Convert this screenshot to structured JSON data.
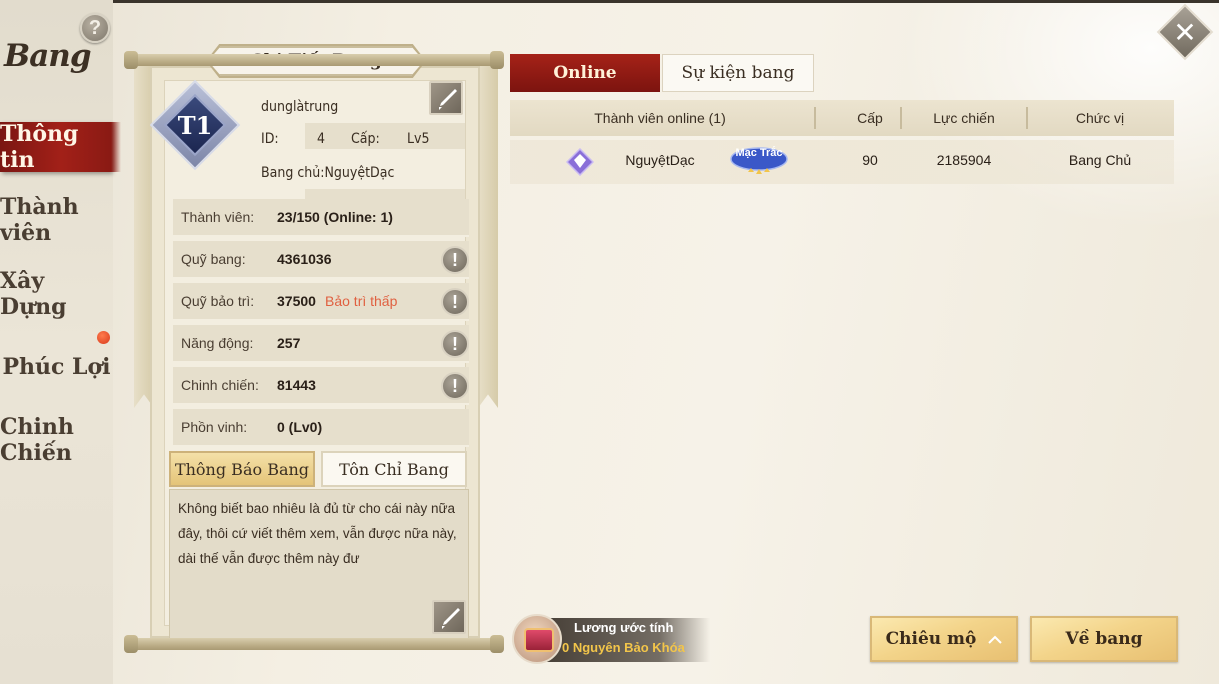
{
  "sidebar": {
    "title": "Bang",
    "help": "?",
    "items": [
      {
        "label": "Thông tin",
        "active": true
      },
      {
        "label": "Thành viên",
        "active": false
      },
      {
        "label": "Xây Dựng",
        "active": false
      },
      {
        "label": "Phúc Lợi",
        "active": false,
        "badge": true
      },
      {
        "label": "Chinh Chiến",
        "active": false
      }
    ]
  },
  "detail": {
    "title": "Chi Tiết Bang",
    "emblem_text": "T1",
    "guild_name": "dunglàtrung",
    "id_label": "ID:",
    "id_value": "4",
    "level_label": "Cấp:",
    "level_value": "Lv5",
    "leader": "Bang chủ:NguyệtDạc",
    "stats": [
      {
        "label": "Thành viên:",
        "value": "23/150   (Online: 1)",
        "warn": "",
        "icon": false
      },
      {
        "label": "Quỹ bang:",
        "value": "4361036",
        "warn": "",
        "icon": true
      },
      {
        "label": "Quỹ bảo trì:",
        "value": "37500",
        "warn": "Bảo trì thấp",
        "icon": true
      },
      {
        "label": "Năng động:",
        "value": "257",
        "warn": "",
        "icon": true
      },
      {
        "label": "Chinh chiến:",
        "value": "81443",
        "warn": "",
        "icon": true
      },
      {
        "label": "Phồn vinh:",
        "value": "0 (Lv0)",
        "warn": "",
        "icon": false
      }
    ],
    "warn_symbol": "!",
    "tabs": {
      "notice": "Thông Báo Bang",
      "purpose": "Tôn Chỉ Bang"
    },
    "notice_text": "Không biết bao nhiêu là đủ từ cho cái này nữa đây, thôi cứ viết thêm xem, vẫn được nữa này, dài thế vẫn được thêm này đư"
  },
  "right": {
    "tabs": {
      "online": "Online",
      "events": "Sự kiện bang"
    },
    "columns": [
      "Thành viên online (1)",
      "Cấp",
      "Lực chiến",
      "Chức vị"
    ],
    "rows": [
      {
        "name": "NguyệtDạc",
        "title_badge": "Mạc Trắc",
        "level": "90",
        "power": "2185904",
        "position": "Bang Chủ"
      }
    ]
  },
  "bottom": {
    "salary_label": "Lương ước tính",
    "salary_value": "0 Nguyên Bảo Khóa",
    "recruit": "Chiêu mộ",
    "back": "Về bang"
  },
  "colors": {
    "accent_red": "#a22018",
    "gold_button": "#f3d48a",
    "warning": "#e06040"
  }
}
